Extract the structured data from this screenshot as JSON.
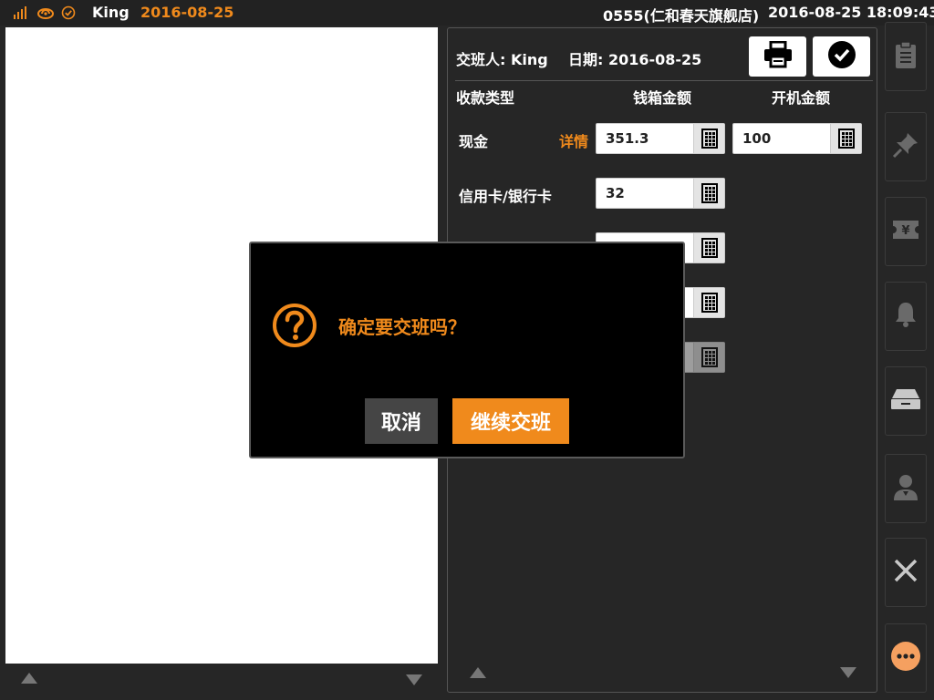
{
  "colors": {
    "accent": "#f08a1c",
    "background": "#262626",
    "modal_bg": "#000000",
    "cancel_btn": "#454545"
  },
  "status_bar": {
    "icons": [
      "signal-icon",
      "cloud-sync-icon",
      "check-circle-icon"
    ],
    "user": "King",
    "date": "2016-08-25",
    "store": "0555(仁和春天旗舰店)",
    "datetime": "2016-08-25 18:09:43"
  },
  "shift_panel": {
    "handover_label": "交班人: King",
    "date_label": "日期: 2016-08-25",
    "toolbar_icons": [
      "printer-icon",
      "confirm-check-icon"
    ],
    "columns": {
      "payment_type": "收款类型",
      "drawer_amount": "钱箱金额",
      "opening_amount": "开机金额"
    },
    "rows": [
      {
        "label": "现金",
        "detail_link": "详情",
        "drawer_amount": "351.3",
        "opening_amount": "100"
      },
      {
        "label": "信用卡/银行卡",
        "drawer_amount": "32"
      },
      {
        "label": "",
        "drawer_amount": ""
      },
      {
        "label": "",
        "drawer_amount": ""
      },
      {
        "label": "",
        "drawer_amount": ""
      }
    ]
  },
  "sidebar": {
    "buttons": [
      "clipboard-icon",
      "pin-icon",
      "yen-ticket-icon",
      "bell-icon",
      "cash-drawer-icon",
      "cashier-icon",
      "close-icon",
      "more-icon"
    ]
  },
  "modal": {
    "icon": "question-circle-icon",
    "message": "确定要交班吗？",
    "cancel_label": "取消",
    "confirm_label": "继续交班"
  }
}
